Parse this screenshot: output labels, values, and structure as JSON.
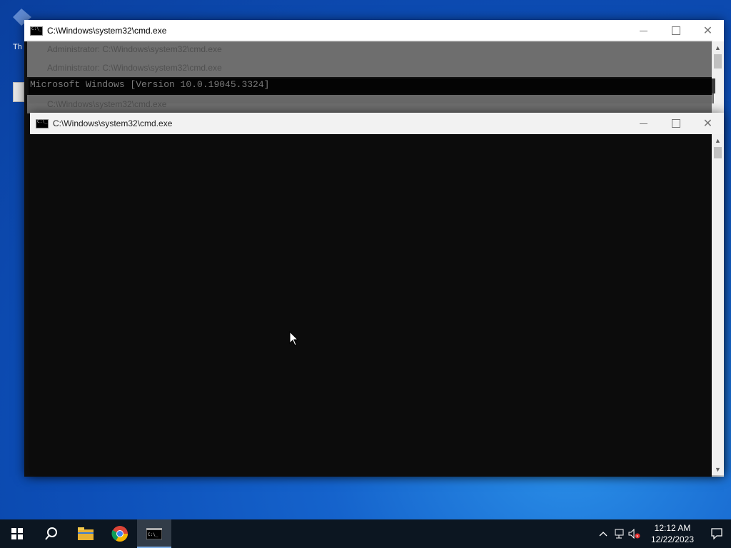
{
  "desktop": {
    "fragment_text": "Th"
  },
  "back_window": {
    "title": "C:\\Windows\\system32\\cmd.exe",
    "ghost_titles": [
      "Administrator: C:\\Windows\\system32\\cmd.exe",
      "Administrator: C:\\Windows\\system32\\cmd.exe",
      "C:\\Windows\\system32\\cmd.exe"
    ],
    "ghost_console_line": "Microsoft Windows [Version 10.0.19045.3324]"
  },
  "front_window": {
    "title": "C:\\Windows\\system32\\cmd.exe",
    "console_text": ""
  },
  "taskbar": {
    "start_icon": "windows-logo-icon",
    "search_icon": "search-icon",
    "pinned": [
      "file-explorer-icon",
      "chrome-icon",
      "cmd-icon"
    ],
    "active_app": "cmd-icon",
    "clock_time": "12:12 AM",
    "clock_date": "12/22/2023"
  },
  "colors": {
    "console_bg": "#0c0c0c",
    "desktop_blue": "#0d4fb8",
    "taskbar_bg": "#0c1621"
  }
}
